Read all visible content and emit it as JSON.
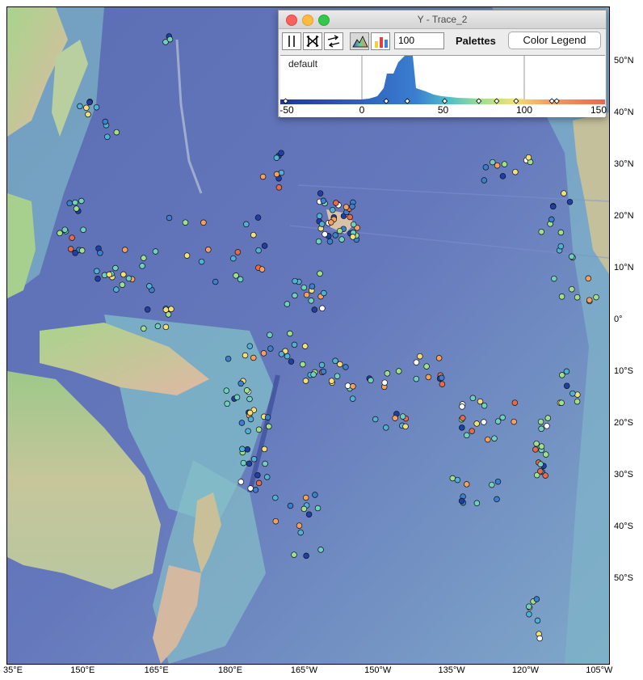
{
  "map": {
    "lat_labels": [
      {
        "lat": 50,
        "text": "50°N"
      },
      {
        "lat": 40,
        "text": "40°N"
      },
      {
        "lat": 30,
        "text": "30°N"
      },
      {
        "lat": 20,
        "text": "20°N"
      },
      {
        "lat": 10,
        "text": "10°N"
      },
      {
        "lat": 0,
        "text": "0°"
      },
      {
        "lat": -10,
        "text": "10°S"
      },
      {
        "lat": -20,
        "text": "20°S"
      },
      {
        "lat": -30,
        "text": "30°S"
      },
      {
        "lat": -40,
        "text": "40°S"
      },
      {
        "lat": -50,
        "text": "50°S"
      }
    ],
    "lon_labels": [
      {
        "lon": 135,
        "text": "35°E"
      },
      {
        "lon": 150,
        "text": "150°E"
      },
      {
        "lon": 165,
        "text": "165°E"
      },
      {
        "lon": 180,
        "text": "180°E"
      },
      {
        "lon": 195,
        "text": "165°W"
      },
      {
        "lon": 210,
        "text": "150°W"
      },
      {
        "lon": 225,
        "text": "135°W"
      },
      {
        "lon": 240,
        "text": "120°W"
      },
      {
        "lon": 255,
        "text": "105°W"
      }
    ],
    "colors": {
      "ocean_deep": "#5d70b6",
      "ocean_mid": "#6f8ec8",
      "shelf": "#8fc7d0",
      "land_low": "#a9d48a",
      "land_high": "#d8b7a0",
      "marker_outline": "#111111"
    },
    "markers_note_colors": [
      "#1f3fa8",
      "#3b7fd0",
      "#4fb0d8",
      "#6fd0c0",
      "#9ee08e",
      "#f2e07a",
      "#f4a060",
      "#e86a4a",
      "#ffffff"
    ]
  },
  "trace_window": {
    "title": "Y - Trace_2",
    "value": "100",
    "palettes_label": "Palettes",
    "color_legend_label": "Color Legend",
    "palette_name": "default",
    "ticks": [
      {
        "v": -50,
        "text": "-50"
      },
      {
        "v": 0,
        "text": "0"
      },
      {
        "v": 50,
        "text": "50"
      },
      {
        "v": 100,
        "text": "100"
      },
      {
        "v": 150,
        "text": "150"
      }
    ]
  }
}
